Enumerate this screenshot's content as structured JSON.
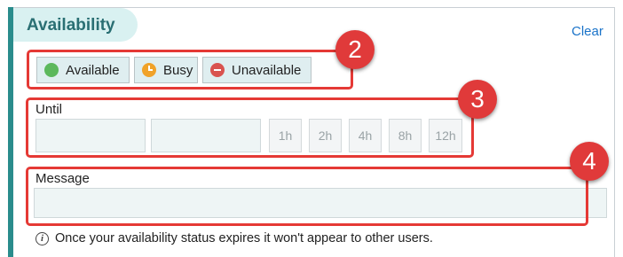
{
  "panel": {
    "title": "Availability",
    "clear_label": "Clear"
  },
  "status": {
    "options": [
      {
        "label": "Available",
        "color": "#5cb85c",
        "icon": "green-circle-icon"
      },
      {
        "label": "Busy",
        "color": "#f0a229",
        "icon": "clock-icon"
      },
      {
        "label": "Unavailable",
        "color": "#d9534f",
        "icon": "minus-circle-icon"
      }
    ]
  },
  "until": {
    "label": "Until",
    "date_value": "",
    "time_value": "",
    "durations": [
      "1h",
      "2h",
      "4h",
      "8h",
      "12h"
    ]
  },
  "message": {
    "label": "Message",
    "value": ""
  },
  "hint": {
    "text": "Once your availability status expires it won't appear to other users."
  },
  "annotations": {
    "badges": [
      "2",
      "3",
      "4"
    ],
    "color": "#e53935"
  }
}
